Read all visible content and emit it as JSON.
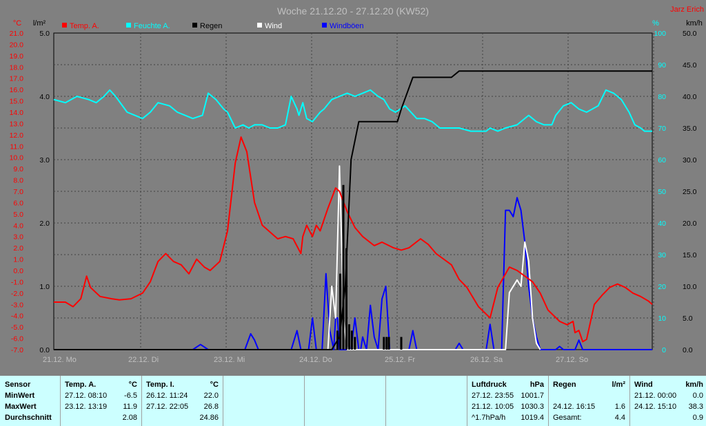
{
  "title": "Woche 21.12.20 - 27.12.20 (KW52)",
  "author": "Jarz Erich",
  "units": {
    "temp": "°C",
    "rad": "l/m²",
    "humidity": "%",
    "wind": "km/h"
  },
  "legend": [
    {
      "label": "Temp. A.",
      "color": "#ff0000"
    },
    {
      "label": "Feuchte A.",
      "color": "#00ffff"
    },
    {
      "label": "Regen",
      "color": "#000000"
    },
    {
      "label": "Wind",
      "color": "#ffffff"
    },
    {
      "label": "Windböen",
      "color": "#0000ff"
    }
  ],
  "chart_data": {
    "type": "line",
    "x_labels": [
      "21.12. Mo",
      "22.12. Di",
      "23.12. Mi",
      "24.12. Do",
      "25.12. Fr",
      "26.12. Sa",
      "27.12. So"
    ],
    "axes": {
      "temp_ticks": [
        "21.0",
        "20.0",
        "19.0",
        "18.0",
        "17.0",
        "16.0",
        "15.0",
        "14.0",
        "13.0",
        "12.0",
        "11.0",
        "10.0",
        "9.0",
        "8.0",
        "7.0",
        "6.0",
        "5.0",
        "4.0",
        "3.0",
        "2.0",
        "1.0",
        "0.0",
        "-1.0",
        "-2.0",
        "-3.0",
        "-4.0",
        "-5.0",
        "-6.0",
        "-7.0"
      ],
      "rain_ticks": [
        "5.0",
        "4.0",
        "3.0",
        "2.0",
        "1.0",
        "0.0"
      ],
      "humidity_ticks": [
        "100",
        "90",
        "80",
        "70",
        "60",
        "50",
        "40",
        "30",
        "20",
        "10",
        "0"
      ],
      "wind_ticks": [
        "50.0",
        "45.0",
        "40.0",
        "35.0",
        "30.0",
        "25.0",
        "20.0",
        "15.0",
        "10.0",
        "5.0",
        "0.0"
      ],
      "temp_range": [
        -7,
        21
      ],
      "rain_range": [
        0,
        5
      ],
      "humidity_range": [
        0,
        100
      ],
      "wind_range": [
        0,
        50
      ]
    },
    "series": [
      {
        "name": "Temp. A.",
        "color": "#ff0000",
        "axis": "temp",
        "points": [
          [
            0,
            -2.8
          ],
          [
            0.3,
            -2.8
          ],
          [
            0.5,
            -3.2
          ],
          [
            0.7,
            -2.5
          ],
          [
            0.85,
            -0.5
          ],
          [
            0.95,
            -1.5
          ],
          [
            1.2,
            -2.3
          ],
          [
            1.5,
            -2.5
          ],
          [
            1.7,
            -2.6
          ],
          [
            2.0,
            -2.5
          ],
          [
            2.3,
            -2.0
          ],
          [
            2.5,
            -1.0
          ],
          [
            2.7,
            0.8
          ],
          [
            2.9,
            1.5
          ],
          [
            3.1,
            0.8
          ],
          [
            3.3,
            0.5
          ],
          [
            3.5,
            -0.3
          ],
          [
            3.7,
            1.0
          ],
          [
            3.9,
            0.3
          ],
          [
            4.05,
            0.0
          ],
          [
            4.3,
            0.8
          ],
          [
            4.5,
            3.5
          ],
          [
            4.7,
            9.5
          ],
          [
            4.85,
            11.8
          ],
          [
            5.0,
            10.5
          ],
          [
            5.2,
            6.0
          ],
          [
            5.4,
            4.0
          ],
          [
            5.8,
            2.8
          ],
          [
            6.0,
            3.0
          ],
          [
            6.2,
            2.8
          ],
          [
            6.4,
            1.5
          ],
          [
            6.45,
            3.0
          ],
          [
            6.55,
            4.0
          ],
          [
            6.7,
            3.0
          ],
          [
            6.8,
            4.0
          ],
          [
            6.9,
            3.5
          ],
          [
            7.1,
            5.5
          ],
          [
            7.3,
            7.3
          ],
          [
            7.4,
            7.0
          ],
          [
            7.6,
            5.2
          ],
          [
            7.8,
            3.8
          ],
          [
            8.0,
            3.0
          ],
          [
            8.3,
            2.2
          ],
          [
            8.5,
            2.5
          ],
          [
            8.8,
            2.0
          ],
          [
            9.0,
            1.8
          ],
          [
            9.2,
            2.0
          ],
          [
            9.5,
            2.8
          ],
          [
            9.7,
            2.3
          ],
          [
            9.9,
            1.5
          ],
          [
            10.3,
            0.5
          ],
          [
            10.5,
            -0.8
          ],
          [
            10.7,
            -1.5
          ],
          [
            11.0,
            -3.2
          ],
          [
            11.3,
            -4.2
          ],
          [
            11.5,
            -1.5
          ],
          [
            11.8,
            0.3
          ],
          [
            12.0,
            0.0
          ],
          [
            12.2,
            -0.5
          ],
          [
            12.4,
            -1.0
          ],
          [
            12.6,
            -2.0
          ],
          [
            12.8,
            -3.5
          ],
          [
            13.1,
            -4.5
          ],
          [
            13.3,
            -4.8
          ],
          [
            13.45,
            -4.5
          ],
          [
            13.5,
            -5.5
          ],
          [
            13.6,
            -5.3
          ],
          [
            13.7,
            -6.3
          ],
          [
            13.8,
            -6.1
          ],
          [
            14.0,
            -3.0
          ],
          [
            14.2,
            -2.2
          ],
          [
            14.4,
            -1.5
          ],
          [
            14.6,
            -1.2
          ],
          [
            14.8,
            -1.5
          ],
          [
            15.0,
            -2.0
          ],
          [
            15.2,
            -2.3
          ],
          [
            15.4,
            -2.7
          ],
          [
            15.5,
            -3.0
          ]
        ]
      },
      {
        "name": "Feuchte A.",
        "color": "#00ffff",
        "axis": "humidity",
        "points": [
          [
            0,
            79
          ],
          [
            0.3,
            78
          ],
          [
            0.6,
            80
          ],
          [
            0.9,
            79
          ],
          [
            1.1,
            78
          ],
          [
            1.3,
            80
          ],
          [
            1.45,
            82
          ],
          [
            1.6,
            80
          ],
          [
            1.9,
            75
          ],
          [
            2.1,
            74
          ],
          [
            2.3,
            73
          ],
          [
            2.5,
            75
          ],
          [
            2.7,
            78
          ],
          [
            3.0,
            77
          ],
          [
            3.2,
            75
          ],
          [
            3.4,
            74
          ],
          [
            3.6,
            73
          ],
          [
            3.85,
            74
          ],
          [
            4.0,
            81
          ],
          [
            4.2,
            79
          ],
          [
            4.4,
            76
          ],
          [
            4.5,
            75
          ],
          [
            4.7,
            70
          ],
          [
            4.9,
            71
          ],
          [
            5.05,
            70
          ],
          [
            5.2,
            71
          ],
          [
            5.4,
            71
          ],
          [
            5.6,
            70
          ],
          [
            5.8,
            70
          ],
          [
            6.0,
            71
          ],
          [
            6.15,
            80
          ],
          [
            6.3,
            76
          ],
          [
            6.35,
            74
          ],
          [
            6.45,
            78
          ],
          [
            6.55,
            73
          ],
          [
            6.7,
            72
          ],
          [
            6.9,
            75
          ],
          [
            7.0,
            76
          ],
          [
            7.2,
            79
          ],
          [
            7.4,
            80
          ],
          [
            7.6,
            81
          ],
          [
            7.8,
            80
          ],
          [
            8.0,
            81
          ],
          [
            8.2,
            82
          ],
          [
            8.4,
            80
          ],
          [
            8.55,
            79
          ],
          [
            8.7,
            76
          ],
          [
            8.85,
            75
          ],
          [
            9.1,
            77
          ],
          [
            9.4,
            73
          ],
          [
            9.6,
            73
          ],
          [
            9.8,
            72
          ],
          [
            10.0,
            70
          ],
          [
            10.2,
            70
          ],
          [
            10.5,
            70
          ],
          [
            10.8,
            69
          ],
          [
            11.1,
            69
          ],
          [
            11.2,
            69
          ],
          [
            11.3,
            70
          ],
          [
            11.5,
            69
          ],
          [
            11.7,
            70
          ],
          [
            12.0,
            71
          ],
          [
            12.3,
            74
          ],
          [
            12.5,
            72
          ],
          [
            12.7,
            71
          ],
          [
            12.9,
            71
          ],
          [
            13.0,
            74
          ],
          [
            13.2,
            77
          ],
          [
            13.4,
            78
          ],
          [
            13.6,
            76
          ],
          [
            13.8,
            75
          ],
          [
            14.1,
            77
          ],
          [
            14.3,
            82
          ],
          [
            14.5,
            81
          ],
          [
            14.7,
            79
          ],
          [
            14.9,
            75
          ],
          [
            15.05,
            71
          ],
          [
            15.2,
            70
          ],
          [
            15.3,
            69
          ],
          [
            15.5,
            69
          ]
        ]
      },
      {
        "name": "Regen",
        "color": "#000000",
        "axis": "rain",
        "points": [
          [
            0,
            0
          ],
          [
            7.2,
            0
          ],
          [
            7.4,
            0.2
          ],
          [
            7.55,
            1.0
          ],
          [
            7.7,
            3.0
          ],
          [
            7.8,
            3.3
          ],
          [
            7.9,
            3.6
          ],
          [
            8.2,
            3.6
          ],
          [
            8.4,
            3.6
          ],
          [
            8.6,
            3.6
          ],
          [
            8.9,
            3.6
          ],
          [
            9.0,
            3.8
          ],
          [
            9.3,
            4.3
          ],
          [
            9.5,
            4.3
          ],
          [
            9.8,
            4.3
          ],
          [
            10.0,
            4.3
          ],
          [
            10.2,
            4.3
          ],
          [
            10.3,
            4.3
          ],
          [
            10.5,
            4.4
          ],
          [
            11.0,
            4.4
          ],
          [
            12.0,
            4.4
          ],
          [
            13.0,
            4.4
          ],
          [
            14.0,
            4.4
          ],
          [
            15.0,
            4.4
          ],
          [
            15.5,
            4.4
          ]
        ]
      },
      {
        "name": "Wind",
        "color": "#ffffff",
        "axis": "wind",
        "points": [
          [
            7.1,
            0
          ],
          [
            7.2,
            10
          ],
          [
            7.3,
            5
          ],
          [
            7.4,
            29
          ],
          [
            7.45,
            18
          ],
          [
            7.5,
            5
          ],
          [
            7.6,
            0
          ],
          [
            11.7,
            0
          ],
          [
            11.8,
            9
          ],
          [
            12.0,
            11
          ],
          [
            12.1,
            10
          ],
          [
            12.2,
            17
          ],
          [
            12.3,
            14
          ],
          [
            12.4,
            5
          ],
          [
            12.5,
            1
          ],
          [
            12.6,
            0
          ]
        ]
      },
      {
        "name": "Windböen",
        "color": "#0000ff",
        "axis": "wind",
        "points": [
          [
            0,
            0
          ],
          [
            3.6,
            0
          ],
          [
            3.8,
            0.8
          ],
          [
            4.0,
            0
          ],
          [
            4.95,
            0
          ],
          [
            5.1,
            2.5
          ],
          [
            5.2,
            1.5
          ],
          [
            5.3,
            0
          ],
          [
            6.15,
            0
          ],
          [
            6.3,
            3
          ],
          [
            6.4,
            0
          ],
          [
            6.6,
            0
          ],
          [
            6.7,
            5
          ],
          [
            6.8,
            0
          ],
          [
            6.95,
            0
          ],
          [
            7.05,
            12
          ],
          [
            7.15,
            3
          ],
          [
            7.25,
            0
          ],
          [
            7.3,
            5
          ],
          [
            7.35,
            5
          ],
          [
            7.4,
            0
          ],
          [
            7.7,
            0
          ],
          [
            7.8,
            5
          ],
          [
            7.9,
            0
          ],
          [
            7.95,
            0
          ],
          [
            8.0,
            2
          ],
          [
            8.1,
            0
          ],
          [
            8.2,
            7
          ],
          [
            8.3,
            2
          ],
          [
            8.4,
            0
          ],
          [
            8.5,
            8
          ],
          [
            8.6,
            10
          ],
          [
            8.65,
            5
          ],
          [
            8.7,
            0
          ],
          [
            9.2,
            0
          ],
          [
            9.3,
            3
          ],
          [
            9.4,
            0
          ],
          [
            10.4,
            0
          ],
          [
            10.5,
            1
          ],
          [
            10.6,
            0
          ],
          [
            11.2,
            0
          ],
          [
            11.3,
            4
          ],
          [
            11.4,
            0
          ],
          [
            11.6,
            0
          ],
          [
            11.7,
            22
          ],
          [
            11.8,
            22
          ],
          [
            11.9,
            21
          ],
          [
            12.0,
            24
          ],
          [
            12.1,
            22
          ],
          [
            12.2,
            17
          ],
          [
            12.3,
            10
          ],
          [
            12.4,
            5
          ],
          [
            12.5,
            2
          ],
          [
            12.6,
            0
          ],
          [
            13.0,
            0
          ],
          [
            13.1,
            0.5
          ],
          [
            13.2,
            0
          ],
          [
            13.5,
            0
          ],
          [
            13.6,
            1.5
          ],
          [
            13.7,
            0
          ],
          [
            15.5,
            0
          ]
        ]
      }
    ],
    "rain_spikes": [
      [
        7.35,
        0.3
      ],
      [
        7.42,
        1.2
      ],
      [
        7.5,
        2.6
      ],
      [
        7.58,
        1.6
      ],
      [
        7.65,
        0.4
      ],
      [
        7.72,
        0.3
      ],
      [
        7.8,
        0.2
      ],
      [
        8.55,
        0.2
      ],
      [
        8.62,
        0.2
      ],
      [
        8.68,
        0.2
      ],
      [
        9.0,
        0.2
      ]
    ]
  },
  "stats": {
    "sensor": {
      "title": "Sensor",
      "rows": [
        "MinWert",
        "MaxWert",
        "Durchschnitt"
      ]
    },
    "temp_a": {
      "title": "Temp. A.",
      "unit": "°C",
      "min_time": "27.12.  08:10",
      "min_val": "-6.5",
      "max_time": "23.12.  13:19",
      "max_val": "11.9",
      "avg_val": "2.08"
    },
    "temp_i": {
      "title": "Temp. I.",
      "unit": "°C",
      "min_time": "26.12.  11:24",
      "min_val": "22.0",
      "max_time": "27.12.  22:05",
      "max_val": "26.8",
      "avg_val": "24.86"
    },
    "pressure": {
      "title": "Luftdruck",
      "unit": "hPa",
      "min_time": "27.12.  23:55",
      "min_val": "1001.7",
      "max_time": "21.12.  10:05",
      "max_val": "1030.3",
      "avg_label": "^1.7hPa/h",
      "avg_val": "1019.4"
    },
    "rain": {
      "title": "Regen",
      "unit": "l/m²",
      "max_time": "24.12.  16:15",
      "max_val": "1.6",
      "total_label": "Gesamt:",
      "total_val": "4.4"
    },
    "wind": {
      "title": "Wind",
      "unit": "km/h",
      "min_time": "21.12.  00:00",
      "min_val": "0.0",
      "max_time": "24.12.  15:10",
      "max_val": "38.3",
      "avg_val": "0.9"
    }
  }
}
